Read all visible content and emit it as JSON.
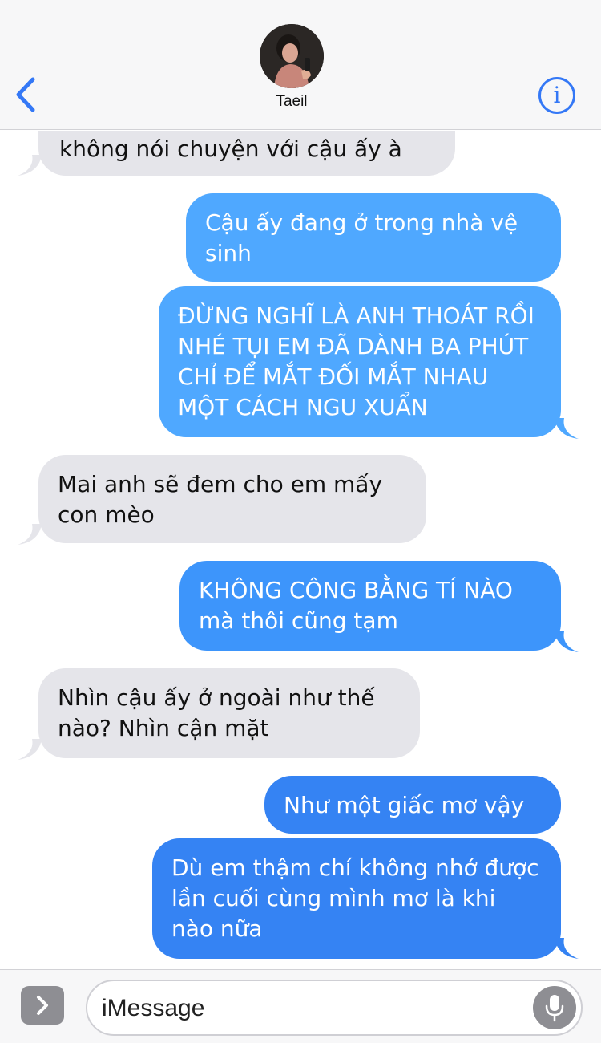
{
  "header": {
    "contact_name": "Taeil",
    "back_icon": "chevron-left-icon",
    "info_icon": "info-icon"
  },
  "colors": {
    "accent": "#3478f6",
    "incoming_bubble": "#e5e5ea",
    "outgoing_light": "#4fa8ff",
    "outgoing_mid": "#3d95fb",
    "outgoing_dark": "#3583f3"
  },
  "messages": [
    {
      "direction": "incoming",
      "text": "không nói chuyện với cậu ấy à"
    },
    {
      "direction": "outgoing",
      "text": "Cậu ấy đang ở trong nhà vệ sinh"
    },
    {
      "direction": "outgoing",
      "text": "ĐỪNG NGHĨ LÀ ANH THOÁT RỒI NHÉ TỤI EM ĐÃ DÀNH BA PHÚT CHỈ ĐỂ MẮT ĐỐI MẮT NHAU MỘT CÁCH NGU XUẨN"
    },
    {
      "direction": "incoming",
      "text": "Mai anh sẽ đem cho em mấy con mèo"
    },
    {
      "direction": "outgoing",
      "text": "KHÔNG CÔNG BẰNG TÍ NÀO mà thôi cũng tạm"
    },
    {
      "direction": "incoming",
      "text": "Nhìn cậu ấy ở ngoài như thế nào? Nhìn cận mặt"
    },
    {
      "direction": "outgoing",
      "text": "Như một giấc mơ vậy"
    },
    {
      "direction": "outgoing",
      "text": "Dù em thậm chí không nhớ được lần cuối cùng mình mơ là khi nào nữa"
    }
  ],
  "composer": {
    "placeholder": "iMessage",
    "expand_icon": "chevron-right-icon",
    "mic_icon": "microphone-icon"
  }
}
